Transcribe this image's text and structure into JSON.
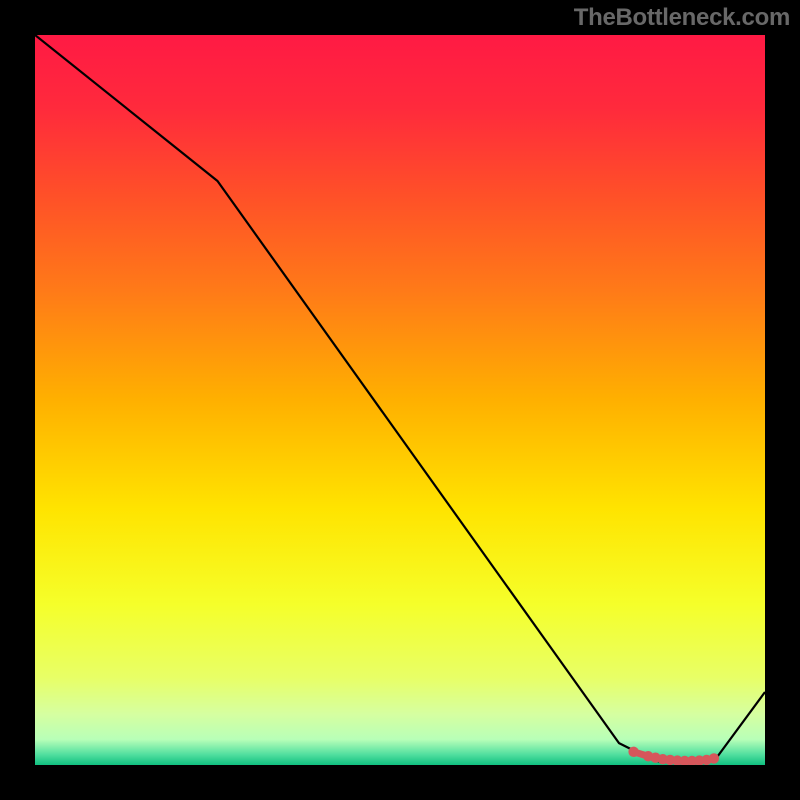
{
  "attribution": "TheBottleneck.com",
  "chart_data": {
    "type": "line",
    "title": "",
    "xlabel": "",
    "ylabel": "",
    "x": [
      0,
      25,
      80,
      85,
      93,
      100
    ],
    "values": [
      100,
      80,
      3,
      0.5,
      0.5,
      10
    ],
    "ylim": [
      0,
      100
    ],
    "xlim": [
      0,
      100
    ],
    "gradient_stops": [
      {
        "offset": 0.0,
        "color": "#ff1a44"
      },
      {
        "offset": 0.1,
        "color": "#ff2a3c"
      },
      {
        "offset": 0.22,
        "color": "#ff5028"
      },
      {
        "offset": 0.35,
        "color": "#ff7a18"
      },
      {
        "offset": 0.5,
        "color": "#ffb000"
      },
      {
        "offset": 0.65,
        "color": "#ffe400"
      },
      {
        "offset": 0.78,
        "color": "#f5ff2a"
      },
      {
        "offset": 0.88,
        "color": "#e8ff66"
      },
      {
        "offset": 0.93,
        "color": "#d6ffa0"
      },
      {
        "offset": 0.965,
        "color": "#b8ffb8"
      },
      {
        "offset": 0.985,
        "color": "#54e0a0"
      },
      {
        "offset": 1.0,
        "color": "#10c080"
      }
    ],
    "series_color": "#000000",
    "marker_color": "#d6565b",
    "marker_points_x": [
      82,
      84,
      85,
      86,
      87,
      88,
      89,
      90,
      91,
      92,
      93
    ],
    "marker_points_y": [
      1.8,
      1.2,
      1.0,
      0.8,
      0.7,
      0.6,
      0.55,
      0.55,
      0.6,
      0.7,
      0.9
    ]
  }
}
